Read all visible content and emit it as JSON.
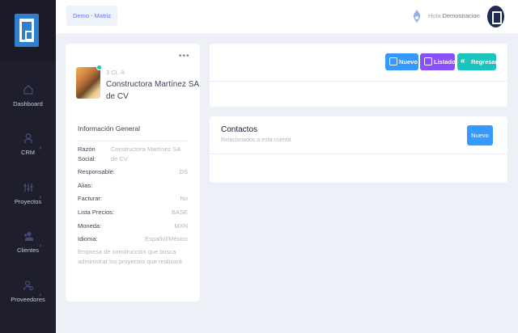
{
  "sidebar": {
    "items": [
      {
        "label": "Dashboard",
        "icon": "home-icon",
        "has_submenu": false
      },
      {
        "label": "CRM",
        "icon": "user-icon",
        "has_submenu": true
      },
      {
        "label": "Proyectos",
        "icon": "sliders-icon",
        "has_submenu": true
      },
      {
        "label": "Clientes",
        "icon": "users-icon",
        "has_submenu": true
      },
      {
        "label": "Proveedores",
        "icon": "user-gear-icon",
        "has_submenu": true
      }
    ]
  },
  "topbar": {
    "company_button": "Demo - Matriz",
    "greeting": "Hola",
    "username": "Demostracion"
  },
  "profile": {
    "code": "3 CL-A",
    "name": "Constructora Martínez SA de CV",
    "info_title": "Información General",
    "fields": [
      {
        "label": "Razón Social:",
        "value": "Constructora Martínez SA de CV"
      },
      {
        "label": "Responsable:",
        "value": "DS"
      },
      {
        "label": "Alias:",
        "value": ""
      },
      {
        "label": "Facturar:",
        "value": "No"
      },
      {
        "label": "Lista Precios:",
        "value": "BASE"
      },
      {
        "label": "Moneda:",
        "value": "MXN"
      },
      {
        "label": "Idioma:",
        "value": "Español/México"
      }
    ],
    "description": "Empresa de construcción que busca administrar los proyectos que realizará"
  },
  "actions": {
    "nuevo": "Nuevo",
    "listado": "Listado",
    "regresar": "Regresar"
  },
  "contacts": {
    "title": "Contactos",
    "subtitle": "Relacionados a esta cuenta",
    "new_button": "Nuevo"
  },
  "colors": {
    "sidebar": "#1e1e2d",
    "primary": "#3699ff",
    "purple": "#8950fc",
    "teal": "#1bc5bd"
  }
}
